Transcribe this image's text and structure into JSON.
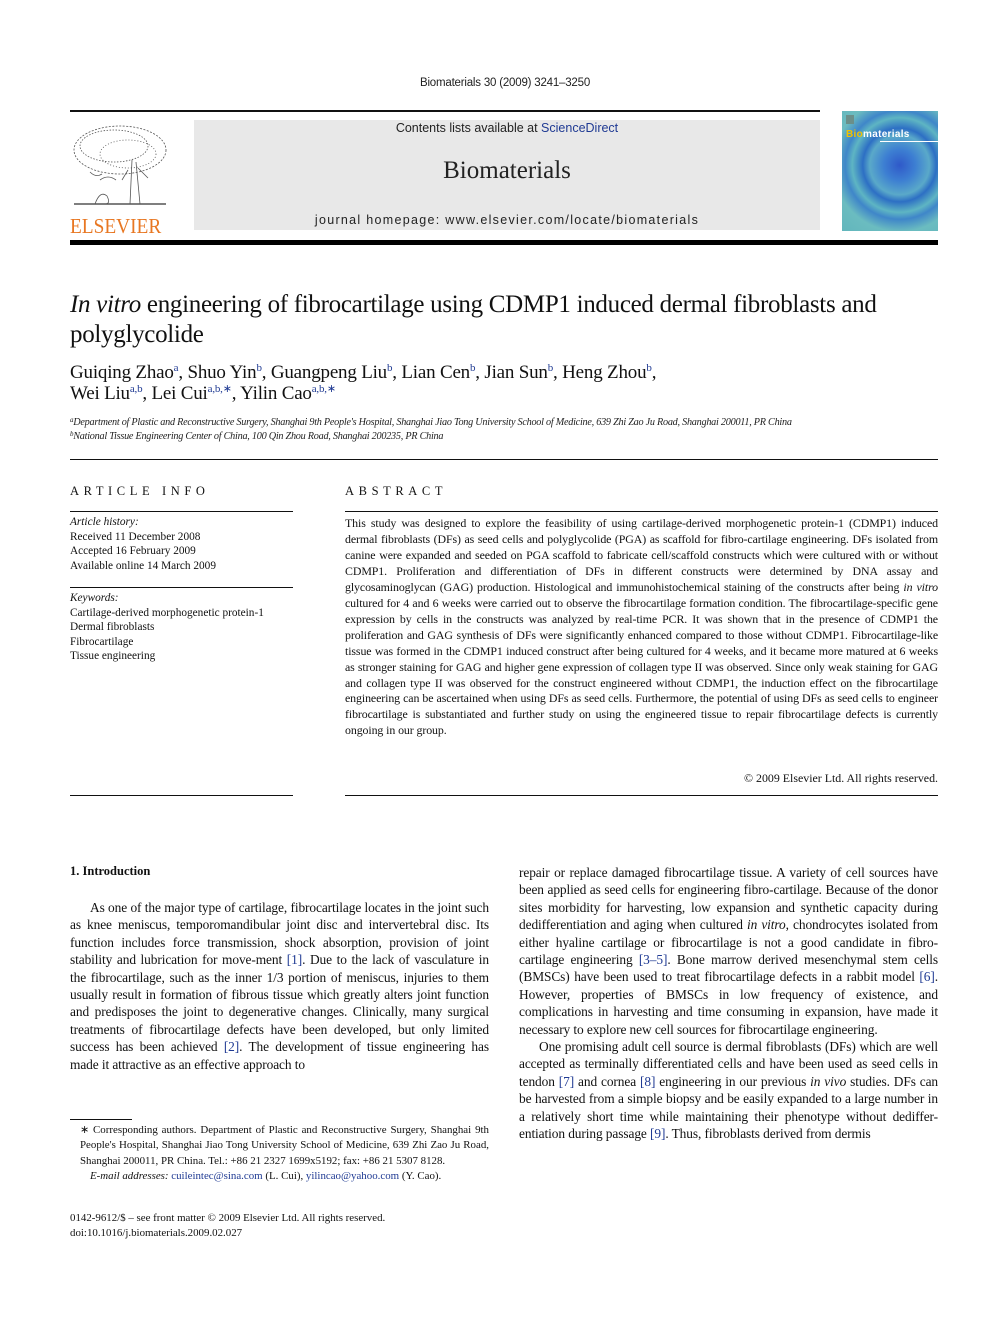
{
  "header": {
    "citation": "Biomaterials 30 (2009) 3241–3250",
    "publisher_logo_text": "ELSEVIER",
    "contents_prefix": "Contents lists available at ",
    "contents_link": "ScienceDirect",
    "journal_name": "Biomaterials",
    "homepage": "journal homepage: www.elsevier.com/locate/biomaterials",
    "cover_title_highlight": "Bio",
    "cover_title_rest": "materials"
  },
  "colors": {
    "link": "#1f3a93",
    "elsevier_orange": "#e87722",
    "banner_bg": "#e8e8e8"
  },
  "article": {
    "title_italic": "In vitro",
    "title_rest": " engineering of fibrocartilage using CDMP1 induced dermal fibroblasts and polyglycolide",
    "authors": [
      {
        "name": "Guiqing Zhao",
        "sup": "a",
        "sep": ", "
      },
      {
        "name": "Shuo Yin",
        "sup": "b",
        "sep": ", "
      },
      {
        "name": "Guangpeng Liu",
        "sup": "b",
        "sep": ", "
      },
      {
        "name": "Lian Cen",
        "sup": "b",
        "sep": ", "
      },
      {
        "name": "Jian Sun",
        "sup": "b",
        "sep": ", "
      },
      {
        "name": "Heng Zhou",
        "sup": "b",
        "sep": ","
      },
      {
        "name": "Wei Liu",
        "sup": "a,b",
        "sep": ", "
      },
      {
        "name": "Lei Cui",
        "sup": "a,b,∗",
        "sep": ", "
      },
      {
        "name": "Yilin Cao",
        "sup": "a,b,∗",
        "sep": ""
      }
    ],
    "affiliations": [
      {
        "sup": "a",
        "text": "Department of Plastic and Reconstructive Surgery, Shanghai 9th People's Hospital, Shanghai Jiao Tong University School of Medicine, 639 Zhi Zao Ju Road, Shanghai 200011, PR China"
      },
      {
        "sup": "b",
        "text": "National Tissue Engineering Center of China, 100 Qin Zhou Road, Shanghai 200235, PR China"
      }
    ]
  },
  "article_info": {
    "heading": "ARTICLE INFO",
    "history_label": "Article history:",
    "history": [
      "Received 11 December 2008",
      "Accepted 16 February 2009",
      "Available online 14 March 2009"
    ],
    "keywords_label": "Keywords:",
    "keywords": [
      "Cartilage-derived morphogenetic protein-1",
      "Dermal fibroblasts",
      "Fibrocartilage",
      "Tissue engineering"
    ]
  },
  "abstract": {
    "heading": "ABSTRACT",
    "part1": "This study was designed to explore the feasibility of using cartilage-derived morphogenetic protein-1 (CDMP1) induced dermal fibroblasts (DFs) as seed cells and polyglycolide (PGA) as scaffold for fibro-cartilage engineering. DFs isolated from canine were expanded and seeded on PGA scaffold to fabricate cell/scaffold constructs which were cultured with or without CDMP1. Proliferation and differentiation of DFs in different constructs were determined by DNA assay and glycosaminoglycan (GAG) production. Histological and immunohistochemical staining of the constructs after being ",
    "italic": "in vitro",
    "part2": " cultured for 4 and 6 weeks were carried out to observe the fibrocartilage formation condition. The fibrocartilage-specific gene expression by cells in the constructs was analyzed by real-time PCR. It was shown that in the presence of CDMP1 the proliferation and GAG synthesis of DFs were significantly enhanced compared to those without CDMP1. Fibrocartilage-like tissue was formed in the CDMP1 induced construct after being cultured for 4 weeks, and it became more matured at 6 weeks as stronger staining for GAG and higher gene expression of collagen type II was observed. Since only weak staining for GAG and collagen type II was observed for the construct engineered without CDMP1, the induction effect on the fibrocartilage engineering can be ascertained when using DFs as seed cells. Furthermore, the potential of using DFs as seed cells to engineer fibrocartilage is substantiated and further study on using the engineered tissue to repair fibrocartilage defects is currently ongoing in our group.",
    "copyright": "© 2009 Elsevier Ltd. All rights reserved."
  },
  "body": {
    "section_heading": "1.  Introduction",
    "left": {
      "p1a": "As one of the major type of cartilage, fibrocartilage locates in the joint such as knee meniscus, temporomandibular joint disc and intervertebral disc. Its function includes force transmission, shock absorption, provision of joint stability and lubrication for move-ment ",
      "ref1": "[1]",
      "p1b": ". Due to the lack of vasculature in the fibrocartilage, such as the inner 1/3 portion of meniscus, injuries to them usually result in formation of fibrous tissue which greatly alters joint function and predisposes the joint to degenerative changes. Clinically, many surgical treatments of fibrocartilage defects have been developed, but only limited success has been achieved ",
      "ref2": "[2]",
      "p1c": ". The development of tissue engineering has made it attractive as an effective approach to"
    },
    "right": {
      "p1a": "repair or replace damaged fibrocartilage tissue. A variety of cell sources have been applied as seed cells for engineering fibro-cartilage. Because of the donor sites morbidity for harvesting, low expansion and synthetic capacity during dedifferentiation and aging when cultured ",
      "italic1": "in vitro",
      "p1b": ", chondrocytes isolated from either hyaline cartilage or fibrocartilage is not a good candidate in fibro-cartilage engineering ",
      "ref3": "[3–5]",
      "p1c": ". Bone marrow derived mesenchymal stem cells (BMSCs) have been used to treat fibrocartilage defects in a rabbit model ",
      "ref4": "[6]",
      "p1d": ". However, properties of BMSCs in low frequency of existence, and complications in harvesting and time consuming in expansion, have made it necessary to explore new cell sources for fibrocartilage engineering.",
      "p2a": "One promising adult cell source is dermal fibroblasts (DFs) which are well accepted as terminally differentiated cells and have been used as seed cells in tendon ",
      "ref5": "[7]",
      "p2b": " and cornea ",
      "ref6": "[8]",
      "p2c": " engineering in our previous ",
      "italic2": "in vivo",
      "p2d": " studies. DFs can be harvested from a simple biopsy and be easily expanded to a large number in a relatively short time while maintaining their phenotype without dediffer-entiation during passage ",
      "ref7": "[9]",
      "p2e": ". Thus, fibroblasts derived from dermis"
    }
  },
  "footnote": {
    "marker": "∗",
    "text": " Corresponding authors. Department of Plastic and Reconstructive Surgery, Shanghai 9th People's Hospital, Shanghai Jiao Tong University School of Medicine, 639 Zhi Zao Ju Road, Shanghai 200011, PR China. Tel.: +86 21 2327 1699x5192; fax: +86 21 5307 8128.",
    "email_label": "E-mail addresses:",
    "email1": "cuileintec@sina.com",
    "email1_owner": " (L. Cui), ",
    "email2": "yilincao@yahoo.com",
    "email2_owner": " (Y. Cao)."
  },
  "front_matter": {
    "issn_line": "0142-9612/$ – see front matter © 2009 Elsevier Ltd. All rights reserved.",
    "doi": "doi:10.1016/j.biomaterials.2009.02.027"
  }
}
